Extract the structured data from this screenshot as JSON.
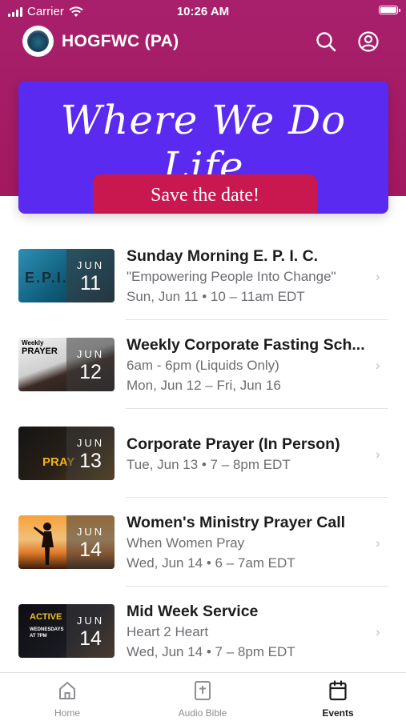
{
  "status": {
    "carrier": "Carrier",
    "time": "10:26 AM"
  },
  "app": {
    "title": "HOGFWC (PA)"
  },
  "banner": {
    "script": "Where We Do Life",
    "button": "Save the date!"
  },
  "thumb_texts": {
    "e0": "E.P.I.",
    "e1": "PRAYER",
    "e1b": "Weekly",
    "e2": "PRAY",
    "e4": "ACTIVE",
    "e4b": "WEDNESDAYS AT 7PM"
  },
  "events": [
    {
      "title": "Sunday Morning E. P. I. C.",
      "subtitle": "\"Empowering People Into Change\"",
      "date": "Sun, Jun 11 • 10 – 11am EDT",
      "month": "JUN",
      "day": "11"
    },
    {
      "title": "Weekly Corporate Fasting Sch...",
      "subtitle": "6am - 6pm (Liquids Only)",
      "date": "Mon, Jun 12 – Fri, Jun 16",
      "month": "JUN",
      "day": "12"
    },
    {
      "title": "Corporate Prayer (In Person)",
      "subtitle": "",
      "date": "Tue, Jun 13 • 7 – 8pm EDT",
      "month": "JUN",
      "day": "13"
    },
    {
      "title": "Women's Ministry Prayer Call",
      "subtitle": "When Women Pray",
      "date": "Wed, Jun 14 • 6 – 7am EDT",
      "month": "JUN",
      "day": "14"
    },
    {
      "title": "Mid Week Service",
      "subtitle": "Heart 2 Heart",
      "date": "Wed, Jun 14 • 7 – 8pm EDT",
      "month": "JUN",
      "day": "14"
    }
  ],
  "tabs": [
    {
      "label": "Home",
      "icon": "home-icon"
    },
    {
      "label": "Audio Bible",
      "icon": "bible-icon"
    },
    {
      "label": "Events",
      "icon": "calendar-icon"
    }
  ],
  "colors": {
    "header": "#a81f6c",
    "banner": "#5a2af0",
    "banner_button": "#c9174f"
  }
}
